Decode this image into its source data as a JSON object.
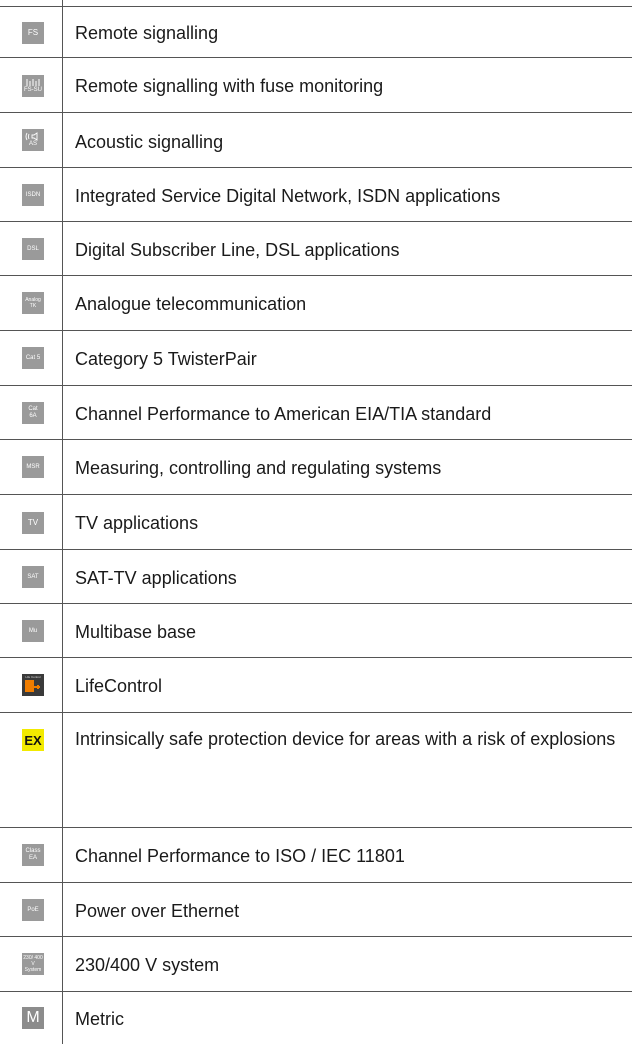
{
  "rows": [
    {
      "icon": "FS",
      "icon_name": "fs-icon",
      "text": "Remote signalling"
    },
    {
      "icon": "FS-SU",
      "icon_name": "fs-su-icon",
      "text": "Remote signalling with fuse monitoring"
    },
    {
      "icon": "AS",
      "icon_name": "acoustic-signal-icon",
      "text": "Acoustic signalling"
    },
    {
      "icon": "ISDN",
      "icon_name": "isdn-icon",
      "text": "Integrated Service Digital Network, ISDN applications"
    },
    {
      "icon": "DSL",
      "icon_name": "dsl-icon",
      "text": "Digital Subscriber Line, DSL applications"
    },
    {
      "icon": "Analog TK",
      "icon_name": "analog-tk-icon",
      "text": "Analogue telecommunication"
    },
    {
      "icon": "Cat 5",
      "icon_name": "cat5-icon",
      "text": "Category 5 TwisterPair"
    },
    {
      "icon": "Cat 6A",
      "icon_name": "cat6a-icon",
      "text": "Channel Performance to American EIA/TIA standard"
    },
    {
      "icon": "MSR",
      "icon_name": "msr-icon",
      "text": "Measuring, controlling and regulating systems"
    },
    {
      "icon": "TV",
      "icon_name": "tv-icon",
      "text": "TV applications"
    },
    {
      "icon": "SAT",
      "icon_name": "sat-icon",
      "text": "SAT-TV applications"
    },
    {
      "icon": "Mu",
      "icon_name": "mu-icon",
      "text": "Multibase base"
    },
    {
      "icon": "Life Control",
      "icon_name": "lifecontrol-icon",
      "text": "LifeControl"
    },
    {
      "icon": "EX",
      "icon_name": "ex-icon",
      "text": "Intrinsically safe protection device for areas with a risk of explosions"
    },
    {
      "icon": "Class EA",
      "icon_name": "class-ea-icon",
      "text": "Channel Performance to ISO / IEC 11801"
    },
    {
      "icon": "PoE",
      "icon_name": "poe-icon",
      "text": "Power over Ethernet"
    },
    {
      "icon": "230/ 400 V System",
      "icon_name": "230-400v-system-icon",
      "text": "230/400 V system"
    },
    {
      "icon": "M",
      "icon_name": "metric-icon",
      "text": "Metric"
    }
  ],
  "colors": {
    "icon_bg": "#9a9a9a",
    "ex_bg": "#f2ea00",
    "lifecontrol_accent": "#f07d00",
    "rule": "#555555"
  }
}
